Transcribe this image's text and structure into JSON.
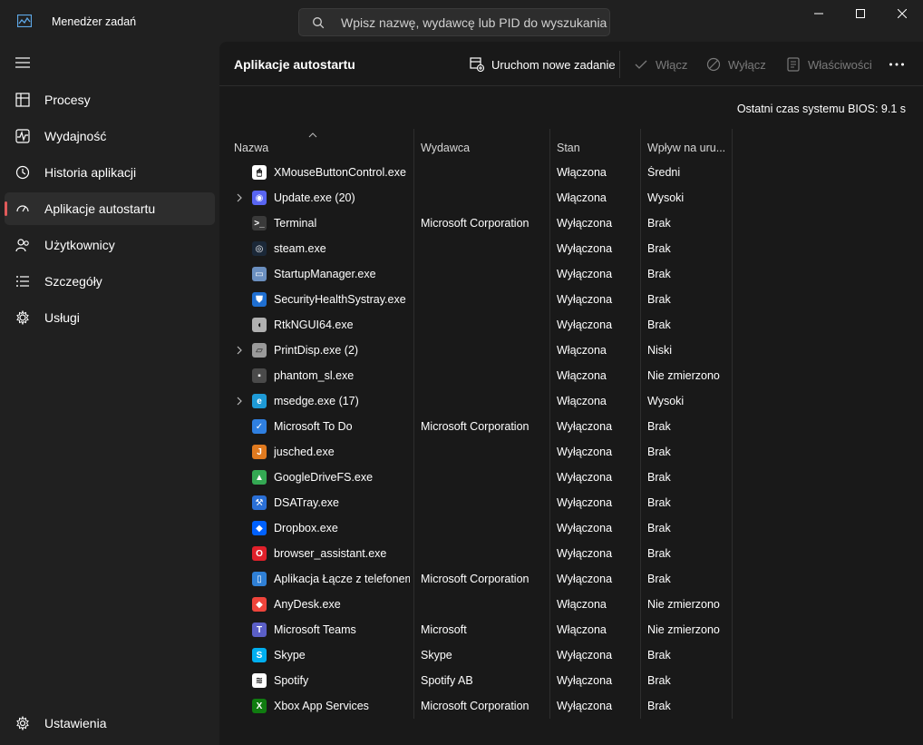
{
  "window": {
    "title": "Menedżer zadań",
    "search_placeholder": "Wpisz nazwę, wydawcę lub PID do wyszukania"
  },
  "sidebar": {
    "items": [
      {
        "label": "Procesy",
        "icon": "processes-icon"
      },
      {
        "label": "Wydajność",
        "icon": "performance-icon"
      },
      {
        "label": "Historia aplikacji",
        "icon": "app-history-icon"
      },
      {
        "label": "Aplikacje autostartu",
        "icon": "startup-apps-icon",
        "active": true
      },
      {
        "label": "Użytkownicy",
        "icon": "users-icon"
      },
      {
        "label": "Szczegóły",
        "icon": "details-icon"
      },
      {
        "label": "Usługi",
        "icon": "services-icon"
      }
    ],
    "settings_label": "Ustawienia"
  },
  "toolbar": {
    "page_title": "Aplikacje autostartu",
    "run_new_task": "Uruchom nowe zadanie",
    "enable": "Włącz",
    "disable": "Wyłącz",
    "properties": "Właściwości"
  },
  "bios_time": "Ostatni czas systemu BIOS:  9.1 s",
  "table": {
    "columns": [
      "Nazwa",
      "Wydawca",
      "Stan",
      "Wpływ na uru..."
    ],
    "rows": [
      {
        "name": "XMouseButtonControl.exe",
        "publisher": "",
        "status": "Włączona",
        "impact": "Średni",
        "expandable": false,
        "icon": "mouse-icon",
        "color": "#ffffff"
      },
      {
        "name": "Update.exe (20)",
        "publisher": "",
        "status": "Włączona",
        "impact": "Wysoki",
        "expandable": true,
        "icon": "discord-icon",
        "color": "#5865f2"
      },
      {
        "name": "Terminal",
        "publisher": "Microsoft Corporation",
        "status": "Wyłączona",
        "impact": "Brak",
        "expandable": false,
        "icon": "terminal-icon",
        "color": "#3a3a3a"
      },
      {
        "name": "steam.exe",
        "publisher": "",
        "status": "Wyłączona",
        "impact": "Brak",
        "expandable": false,
        "icon": "steam-icon",
        "color": "#1b2838"
      },
      {
        "name": "StartupManager.exe",
        "publisher": "",
        "status": "Wyłączona",
        "impact": "Brak",
        "expandable": false,
        "icon": "window-icon",
        "color": "#6b8fbf"
      },
      {
        "name": "SecurityHealthSystray.exe",
        "publisher": "",
        "status": "Wyłączona",
        "impact": "Brak",
        "expandable": false,
        "icon": "shield-icon",
        "color": "#1f6fd1"
      },
      {
        "name": "RtkNGUI64.exe",
        "publisher": "",
        "status": "Wyłączona",
        "impact": "Brak",
        "expandable": false,
        "icon": "speaker-icon",
        "color": "#b0b0b0"
      },
      {
        "name": "PrintDisp.exe (2)",
        "publisher": "",
        "status": "Włączona",
        "impact": "Niski",
        "expandable": true,
        "icon": "printer-icon",
        "color": "#9a9a9a"
      },
      {
        "name": "phantom_sl.exe",
        "publisher": "",
        "status": "Włączona",
        "impact": "Nie zmierzono",
        "expandable": false,
        "icon": "app-icon",
        "color": "#4a4a4a"
      },
      {
        "name": "msedge.exe (17)",
        "publisher": "",
        "status": "Włączona",
        "impact": "Wysoki",
        "expandable": true,
        "icon": "edge-icon",
        "color": "#1e9ad6"
      },
      {
        "name": "Microsoft To Do",
        "publisher": "Microsoft Corporation",
        "status": "Wyłączona",
        "impact": "Brak",
        "expandable": false,
        "icon": "checkmark-icon",
        "color": "#2f7fe0"
      },
      {
        "name": "jusched.exe",
        "publisher": "",
        "status": "Wyłączona",
        "impact": "Brak",
        "expandable": false,
        "icon": "java-icon",
        "color": "#e07a1f"
      },
      {
        "name": "GoogleDriveFS.exe",
        "publisher": "",
        "status": "Wyłączona",
        "impact": "Brak",
        "expandable": false,
        "icon": "google-drive-icon",
        "color": "#34a853"
      },
      {
        "name": "DSATray.exe",
        "publisher": "",
        "status": "Wyłączona",
        "impact": "Brak",
        "expandable": false,
        "icon": "wrench-icon",
        "color": "#2a6fd6"
      },
      {
        "name": "Dropbox.exe",
        "publisher": "",
        "status": "Wyłączona",
        "impact": "Brak",
        "expandable": false,
        "icon": "dropbox-icon",
        "color": "#0061fe"
      },
      {
        "name": "browser_assistant.exe",
        "publisher": "",
        "status": "Wyłączona",
        "impact": "Brak",
        "expandable": false,
        "icon": "opera-icon",
        "color": "#e0202a"
      },
      {
        "name": "Aplikacja Łącze z telefonem",
        "publisher": "Microsoft Corporation",
        "status": "Wyłączona",
        "impact": "Brak",
        "expandable": false,
        "icon": "phone-link-icon",
        "color": "#2f80d6"
      },
      {
        "name": "AnyDesk.exe",
        "publisher": "",
        "status": "Włączona",
        "impact": "Nie zmierzono",
        "expandable": false,
        "icon": "anydesk-icon",
        "color": "#ef443b"
      },
      {
        "name": "Microsoft Teams",
        "publisher": "Microsoft",
        "status": "Włączona",
        "impact": "Nie zmierzono",
        "expandable": false,
        "icon": "teams-icon",
        "color": "#5b5fc7"
      },
      {
        "name": "Skype",
        "publisher": "Skype",
        "status": "Wyłączona",
        "impact": "Brak",
        "expandable": false,
        "icon": "skype-icon",
        "color": "#00aff0"
      },
      {
        "name": "Spotify",
        "publisher": "Spotify AB",
        "status": "Wyłączona",
        "impact": "Brak",
        "expandable": false,
        "icon": "spotify-icon",
        "color": "#ffffff"
      },
      {
        "name": "Xbox App Services",
        "publisher": "Microsoft Corporation",
        "status": "Wyłączona",
        "impact": "Brak",
        "expandable": false,
        "icon": "xbox-icon",
        "color": "#107c10"
      }
    ]
  },
  "colors": {
    "accent": "#e05a5a",
    "background": "#202020",
    "content_background": "#191919"
  }
}
